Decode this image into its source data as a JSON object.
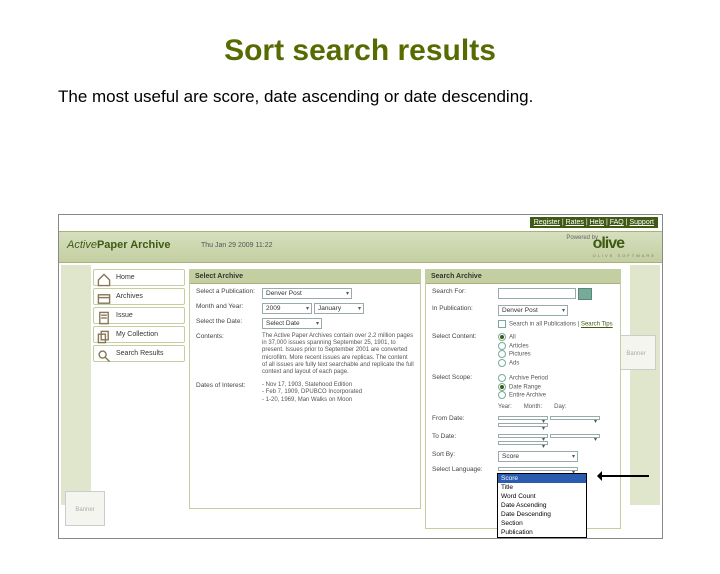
{
  "slide": {
    "title": "Sort search results",
    "subtitle": "The most useful are score, date ascending or date descending."
  },
  "top_links": [
    "Register",
    "Rates",
    "Help",
    "FAQ",
    "Support"
  ],
  "header": {
    "brand_prefix": "Active",
    "brand_main": "Paper Archive",
    "datetime": "Thu Jan 29 2009 11:22",
    "powered": "Powered by",
    "olive": "olive",
    "olive_sub": "OLIVE SOFTWARE"
  },
  "nav": [
    {
      "icon": "home",
      "label": "Home"
    },
    {
      "icon": "archives",
      "label": "Archives"
    },
    {
      "icon": "issue",
      "label": "Issue"
    },
    {
      "icon": "collection",
      "label": "My Collection"
    },
    {
      "icon": "results",
      "label": "Search Results"
    }
  ],
  "banner_label": "Banner",
  "archive_panel": {
    "title": "Select Archive",
    "pub_label": "Select a Publication:",
    "pub_value": "Denver Post",
    "month_label": "Month and Year:",
    "year_value": "2009",
    "month_value": "January",
    "date_label": "Select the Date:",
    "date_value": "Select Date",
    "contents_label": "Contents:",
    "contents_text": "The Active Paper Archives contain over 2.2 million pages in 37,000 issues spanning September 25, 1901, to present. Issues prior to September 2001 are converted microfilm. More recent issues are replicas. The content of all issues are fully text searchable and replicate the full context and layout of each page.",
    "dates_label": "Dates of Interest:",
    "dates_text": "- Nov 17, 1903, Statehood Edition\n- Feb 7, 1909, DPUBCO Incorporated\n- 1-20, 1969, Man Walks on Moon"
  },
  "search_panel": {
    "title": "Search Archive",
    "for_label": "Search For:",
    "in_label": "In Publication:",
    "in_value": "Denver Post",
    "search_all": "Search in all Publications",
    "tips": "Search Tips",
    "content_label": "Select Content:",
    "content_options": [
      "All",
      "Articles",
      "Pictures",
      "Ads"
    ],
    "scope_label": "Select Scope:",
    "scope_options": [
      "Archive Period",
      "Date Range",
      "Entire Archive"
    ],
    "scope_selected": 1,
    "yr": "Year:",
    "mo": "Month:",
    "dy": "Day:",
    "from": "From Date:",
    "to": "To Date:",
    "sort_label": "Sort By:",
    "sort_value": "Score",
    "lang_label": "Select Language:",
    "sort_options": [
      "Score",
      "Title",
      "Word Count",
      "Date Ascending",
      "Date Descending",
      "Section",
      "Publication"
    ]
  }
}
